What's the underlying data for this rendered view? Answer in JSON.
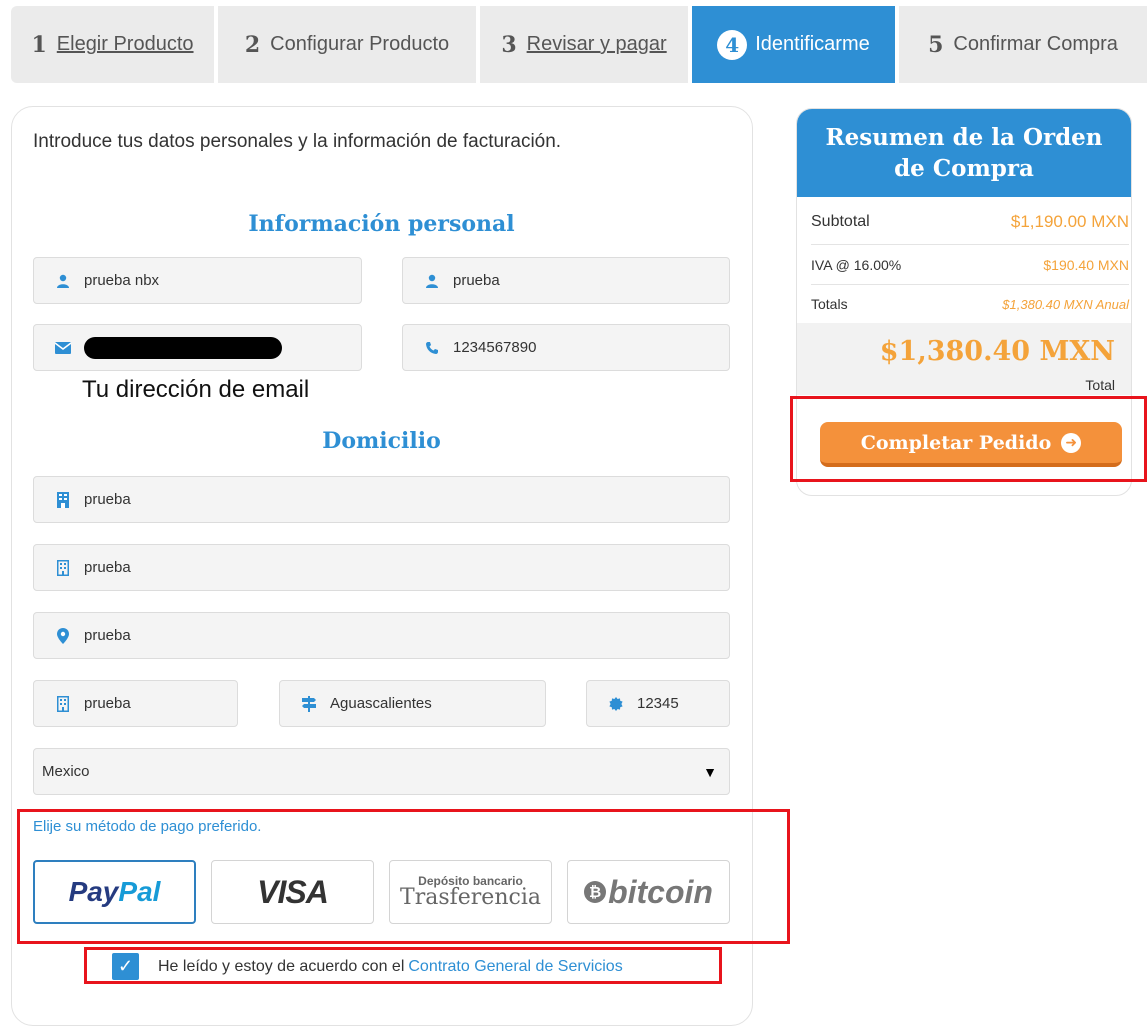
{
  "steps": [
    {
      "num": "1",
      "label": "Elegir Producto"
    },
    {
      "num": "2",
      "label": "Configurar Producto"
    },
    {
      "num": "3",
      "label": "Revisar y pagar"
    },
    {
      "num": "4",
      "label": "Identificarme"
    },
    {
      "num": "5",
      "label": "Confirmar Compra"
    }
  ],
  "form": {
    "intro": "Introduce tus datos personales y la información de facturación.",
    "personal_title": "Información personal",
    "first_name": "prueba nbx",
    "last_name": "prueba",
    "phone": "1234567890",
    "email_caption": "Tu dirección de email",
    "address_title": "Domicilio",
    "company": "prueba",
    "address1": "prueba",
    "address2": "prueba",
    "city": "prueba",
    "state": "Aguascalientes",
    "postcode": "12345",
    "country": "Mexico"
  },
  "payment": {
    "label": "Elije su método de pago preferido.",
    "paypal": {
      "pay": "Pay",
      "pal": "Pal"
    },
    "visa": "VISA",
    "bank_line1": "Depósito bancario",
    "bank_line2": "Trasferencia",
    "bitcoin": "bitcoin"
  },
  "terms": {
    "text": "He leído y estoy de acuerdo con el",
    "link": "Contrato General de Servicios",
    "checked": true
  },
  "summary": {
    "title": "Resumen de la Orden de Compra",
    "subtotal_label": "Subtotal",
    "subtotal_value": "$1,190.00 MXN",
    "tax_label": "IVA @ 16.00%",
    "tax_value": "$190.40 MXN",
    "totals_label": "Totals",
    "totals_value": "$1,380.40 MXN Anual",
    "total_amount": "$1,380.40 MXN",
    "total_label": "Total",
    "complete_button": "Completar Pedido"
  },
  "colors": {
    "primary": "#2e8fd4",
    "accent_orange": "#f4913b",
    "price_orange": "#f4a33a",
    "highlight_red": "#e8141c"
  },
  "icons": {
    "user": "user-icon",
    "email": "envelope-icon",
    "phone": "phone-icon",
    "building": "building-icon",
    "location": "map-marker-icon",
    "signpost": "signpost-icon",
    "postcode": "certificate-icon",
    "arrow": "arrow-circle-right-icon",
    "check": "check-icon"
  }
}
